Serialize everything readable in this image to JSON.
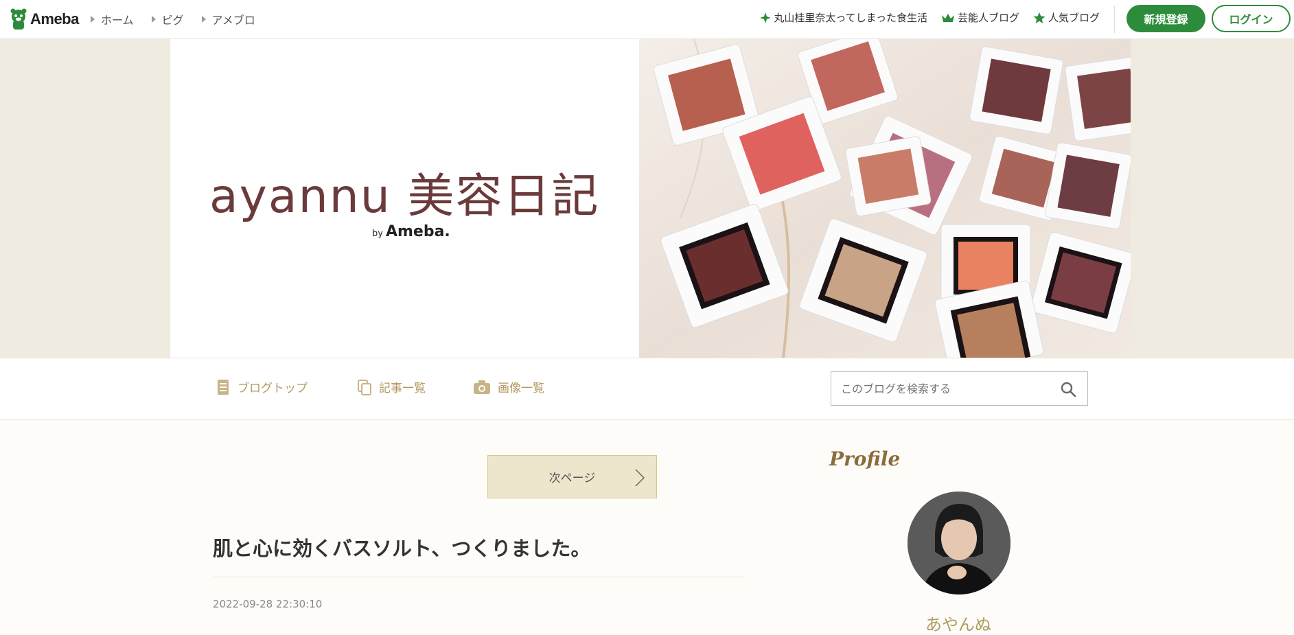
{
  "topbar": {
    "logo": "Ameba",
    "breadcrumbs": [
      "ホーム",
      "ピグ",
      "アメブロ"
    ],
    "links": [
      {
        "label": "丸山桂里奈太ってしまった食生活",
        "icon": "sparkle-icon"
      },
      {
        "label": "芸能人ブログ",
        "icon": "crown-icon"
      },
      {
        "label": "人気ブログ",
        "icon": "star-icon"
      }
    ],
    "signup_label": "新規登録",
    "login_label": "ログイン"
  },
  "header": {
    "title": "ayannu 美容日記",
    "by": "by",
    "brand": "Ameba."
  },
  "nav": {
    "items": [
      {
        "label": "ブログトップ",
        "icon": "document-icon"
      },
      {
        "label": "記事一覧",
        "icon": "copy-icon"
      },
      {
        "label": "画像一覧",
        "icon": "camera-icon"
      }
    ],
    "search_placeholder": "このブログを検索する"
  },
  "main": {
    "next_page_label": "次ページ",
    "article_title": "肌と心に効くバスソルト、つくりました。",
    "article_date": "2022-09-28 22:30:10"
  },
  "sidebar": {
    "profile_heading": "Profile",
    "profile_name": "あやんぬ"
  },
  "colors": {
    "brand_green": "#2d8c3c",
    "accent_gold": "#b39a62",
    "title_maroon": "#6b3a3a"
  }
}
